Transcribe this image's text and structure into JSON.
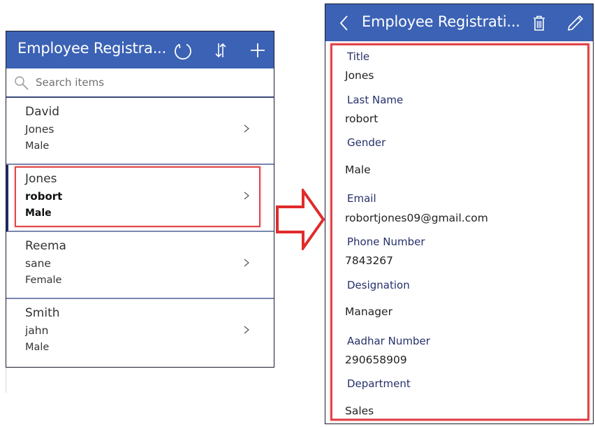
{
  "browse": {
    "title": "Employee Registra...",
    "icons": {
      "refresh": "refresh-icon",
      "sort": "sort-icon",
      "add": "plus-icon"
    },
    "search": {
      "placeholder": "Search items",
      "value": ""
    },
    "items": [
      {
        "title": "David",
        "subtitle": "Jones",
        "body": "Male",
        "selected": false
      },
      {
        "title": "Jones",
        "subtitle": "robort",
        "body": "Male",
        "selected": true
      },
      {
        "title": "Reema",
        "subtitle": "sane",
        "body": "Female",
        "selected": false
      },
      {
        "title": "Smith",
        "subtitle": "jahn",
        "body": "Male",
        "selected": false
      }
    ]
  },
  "detail": {
    "title": "Employee Registrati...",
    "icons": {
      "back": "chevron-left-icon",
      "delete": "trash-icon",
      "edit": "pencil-icon"
    },
    "fields": [
      {
        "label": "Title",
        "value": "Jones"
      },
      {
        "label": "Last Name",
        "value": "robort"
      },
      {
        "label": "Gender",
        "value": "Male"
      },
      {
        "label": "Email",
        "value": "robortjones09@gmail.com"
      },
      {
        "label": "Phone Number",
        "value": "7843267"
      },
      {
        "label": "Designation",
        "value": "Manager"
      },
      {
        "label": "Aadhar Number",
        "value": "290658909"
      },
      {
        "label": "Department",
        "value": "Sales"
      }
    ]
  },
  "colors": {
    "header": "#3b62b4",
    "highlight": "#e0474c",
    "label": "#26306a"
  }
}
